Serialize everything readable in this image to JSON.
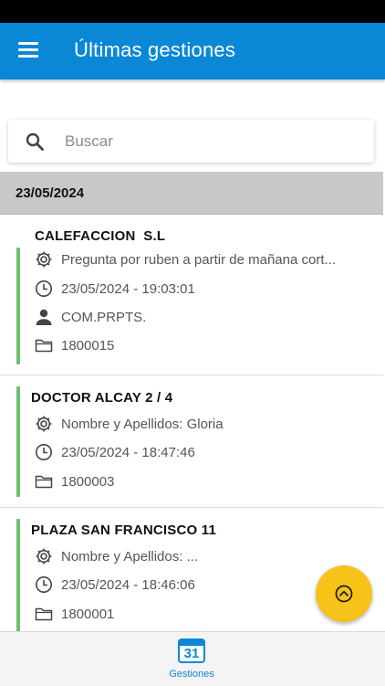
{
  "header": {
    "title": "Últimas gestiones"
  },
  "search": {
    "placeholder": "Buscar",
    "value": ""
  },
  "date_group": "23/05/2024",
  "items": [
    {
      "title": "CALEFACCION  S.L",
      "description": "Pregunta por ruben a partir de mañana cort...",
      "datetime": "23/05/2024 - 19:03:01",
      "user": "COM.PRPTS.",
      "folder": "1800015"
    },
    {
      "title": "DOCTOR ALCAY 2 / 4",
      "description": "Nombre y Apellidos: Gloria",
      "datetime": "23/05/2024 - 18:47:46",
      "folder": "1800003"
    },
    {
      "title": "PLAZA SAN FRANCISCO 11",
      "description": "Nombre y Apellidos:  ...",
      "datetime": "23/05/2024 - 18:46:06",
      "folder": "1800001"
    }
  ],
  "bottom_nav": {
    "tab_label": "Gestiones",
    "calendar_day": "31"
  },
  "colors": {
    "primary": "#0a88d6",
    "accent": "#f7c21a",
    "status_bar": "#6cbf6c"
  },
  "icons": [
    "menu-icon",
    "search-icon",
    "gear-icon",
    "clock-icon",
    "person-icon",
    "folder-icon",
    "chevron-up-icon",
    "calendar-icon"
  ]
}
